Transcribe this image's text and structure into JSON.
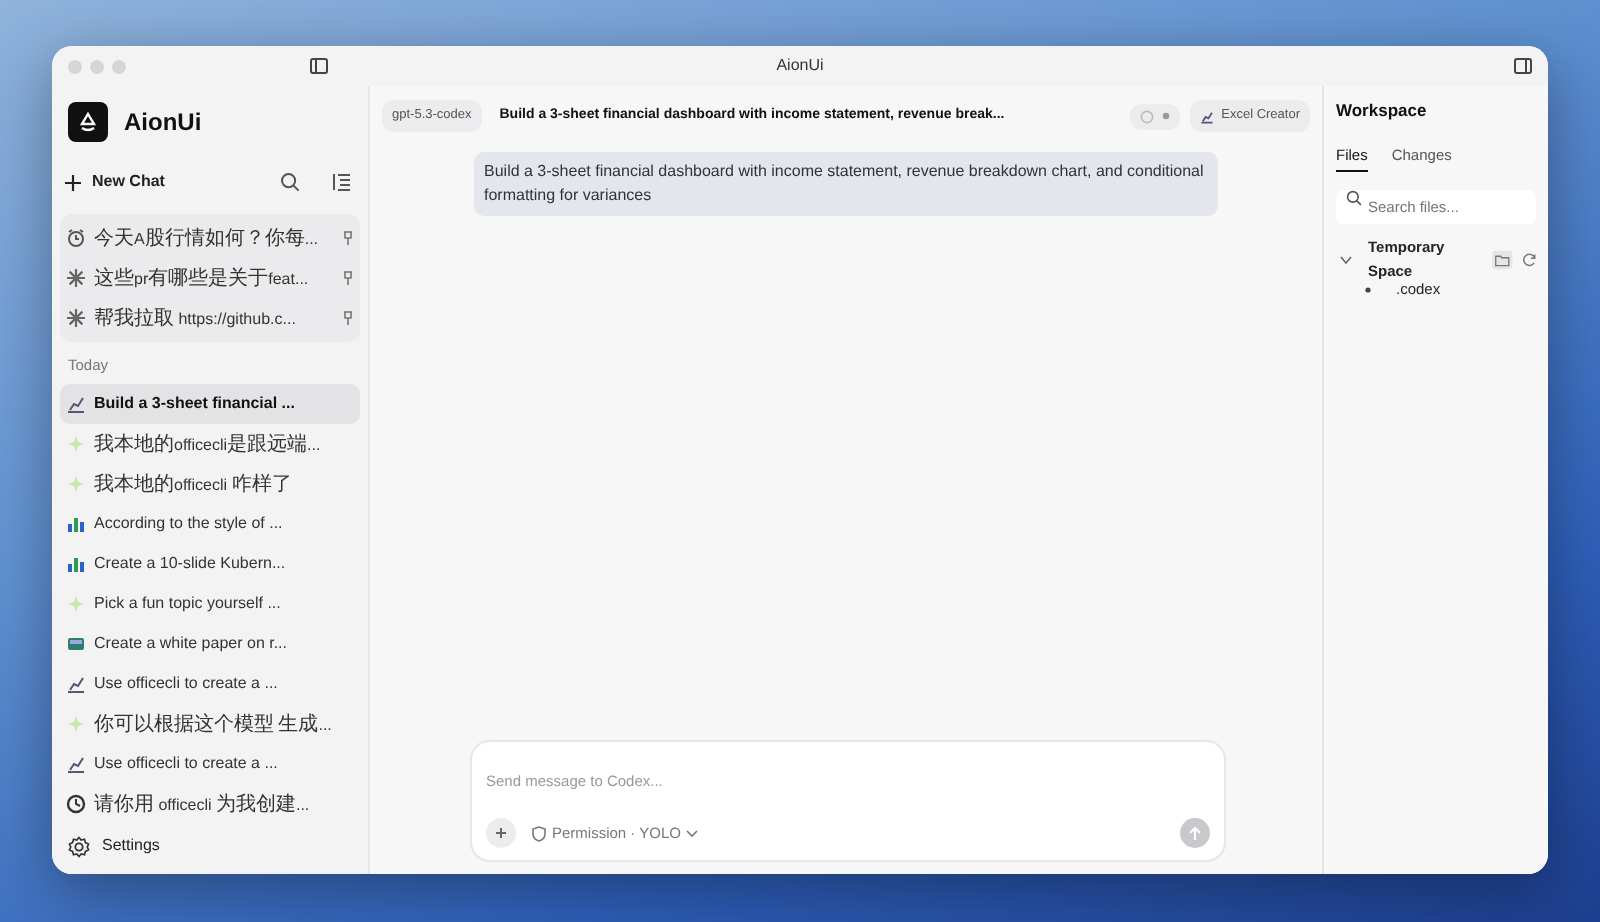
{
  "window": {
    "title": "AionUi"
  },
  "sidebar": {
    "app_name": "AionUi",
    "new_chat": "New Chat",
    "pinned": [
      {
        "title": "今天A股行情如何？你每...",
        "kind": "alarm"
      },
      {
        "title": "这些pr有哪些是关于feat...",
        "kind": "burst"
      },
      {
        "title": "帮我拉取 https://github.c...",
        "kind": "burst"
      }
    ],
    "section_label": "Today",
    "items": [
      {
        "title": "Build a 3-sheet financial ...",
        "kind": "chart",
        "selected": true
      },
      {
        "title": "我本地的officecli是跟远端...",
        "kind": "sparkle",
        "selected": false
      },
      {
        "title": "我本地的officecli 咋样了",
        "kind": "sparkle",
        "selected": false
      },
      {
        "title": "According to the style of ...",
        "kind": "bars",
        "selected": false
      },
      {
        "title": "Create a 10-slide Kubern...",
        "kind": "bars",
        "selected": false
      },
      {
        "title": "Pick a fun topic yourself ...",
        "kind": "sparkle",
        "selected": false
      },
      {
        "title": "Create a white paper on r...",
        "kind": "book",
        "selected": false
      },
      {
        "title": "Use officecli to create a ...",
        "kind": "chart",
        "selected": false
      },
      {
        "title": "你可以根据这个模型 生成...",
        "kind": "sparkle",
        "selected": false
      },
      {
        "title": "Use officecli to create a ...",
        "kind": "chart",
        "selected": false
      },
      {
        "title": "请你用 officecli 为我创建...",
        "kind": "clock",
        "selected": false
      }
    ],
    "settings": "Settings"
  },
  "chat": {
    "model": "gpt-5.3-codex",
    "title": "Build a 3-sheet financial dashboard with income statement, revenue break...",
    "agent": "Excel Creator",
    "messages": [
      {
        "text": "Build a 3-sheet financial dashboard with income statement, revenue breakdown chart, and conditional formatting for variances"
      }
    ],
    "composer": {
      "placeholder": "Send message to Codex...",
      "permission": "Permission · YOLO"
    }
  },
  "workspace": {
    "title": "Workspace",
    "tabs": [
      {
        "label": "Files",
        "selected": true
      },
      {
        "label": "Changes",
        "selected": false
      }
    ],
    "search": {
      "placeholder": "Search files..."
    },
    "tree": [
      {
        "name": "Temporary Space",
        "expanded": true,
        "children": [
          {
            "name": ".codex"
          }
        ]
      }
    ]
  }
}
